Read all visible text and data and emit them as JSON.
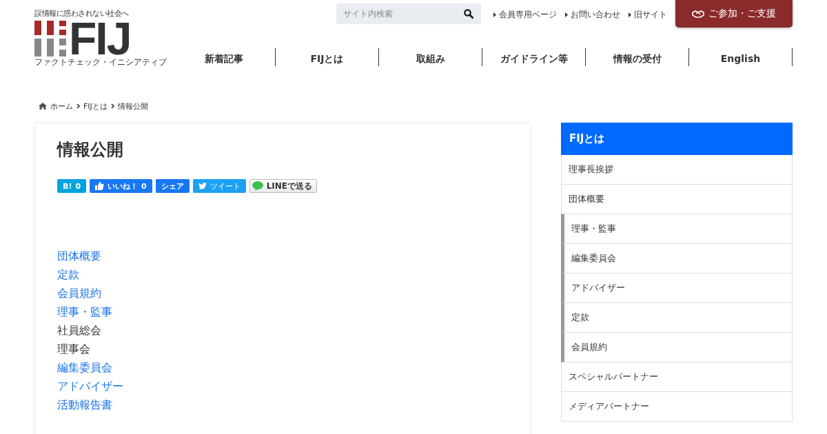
{
  "header": {
    "tagline": "誤情報に惑わされない社会へ",
    "logo_text": "FIJ",
    "logo_caption": "ファクトチェック・イニシアティブ",
    "search": {
      "placeholder": "サイト内検索"
    },
    "top_links": [
      "会員専用ページ",
      "お問い合わせ",
      "旧サイト"
    ],
    "support_button": "ご参加・ご支援",
    "nav": [
      "新着記事",
      "FIJとは",
      "取組み",
      "ガイドライン等",
      "情報の受付",
      "English"
    ]
  },
  "breadcrumb": [
    "ホーム",
    "FIJとは",
    "情報公開"
  ],
  "article": {
    "title": "情報公開",
    "share_buttons": [
      {
        "kind": "hatena",
        "label": "B!",
        "count": "0"
      },
      {
        "kind": "like",
        "label": "いいね！",
        "count": "0"
      },
      {
        "kind": "share",
        "label": "シェア"
      },
      {
        "kind": "tweet",
        "label": "ツイート"
      },
      {
        "kind": "line",
        "label": "LINEで送る"
      }
    ],
    "links": [
      {
        "text": "団体概要",
        "link": true
      },
      {
        "text": "定款",
        "link": true
      },
      {
        "text": "会員規約",
        "link": true
      },
      {
        "text": "理事・監事",
        "link": true
      },
      {
        "text": "社員総会",
        "link": false
      },
      {
        "text": "理事会",
        "link": false
      },
      {
        "text": "編集委員会",
        "link": true
      },
      {
        "text": "アドバイザー",
        "link": true
      },
      {
        "text": "活動報告書",
        "link": true
      }
    ]
  },
  "sidebar": {
    "title": "FIJとは",
    "items": [
      {
        "label": "理事長挨拶"
      },
      {
        "label": "団体概要",
        "children": [
          {
            "label": "理事・監事"
          },
          {
            "label": "編集委員会"
          },
          {
            "label": "アドバイザー"
          },
          {
            "label": "定款"
          },
          {
            "label": "会員規約"
          }
        ]
      },
      {
        "label": "スペシャルパートナー"
      },
      {
        "label": "メディアパートナー"
      }
    ]
  }
}
